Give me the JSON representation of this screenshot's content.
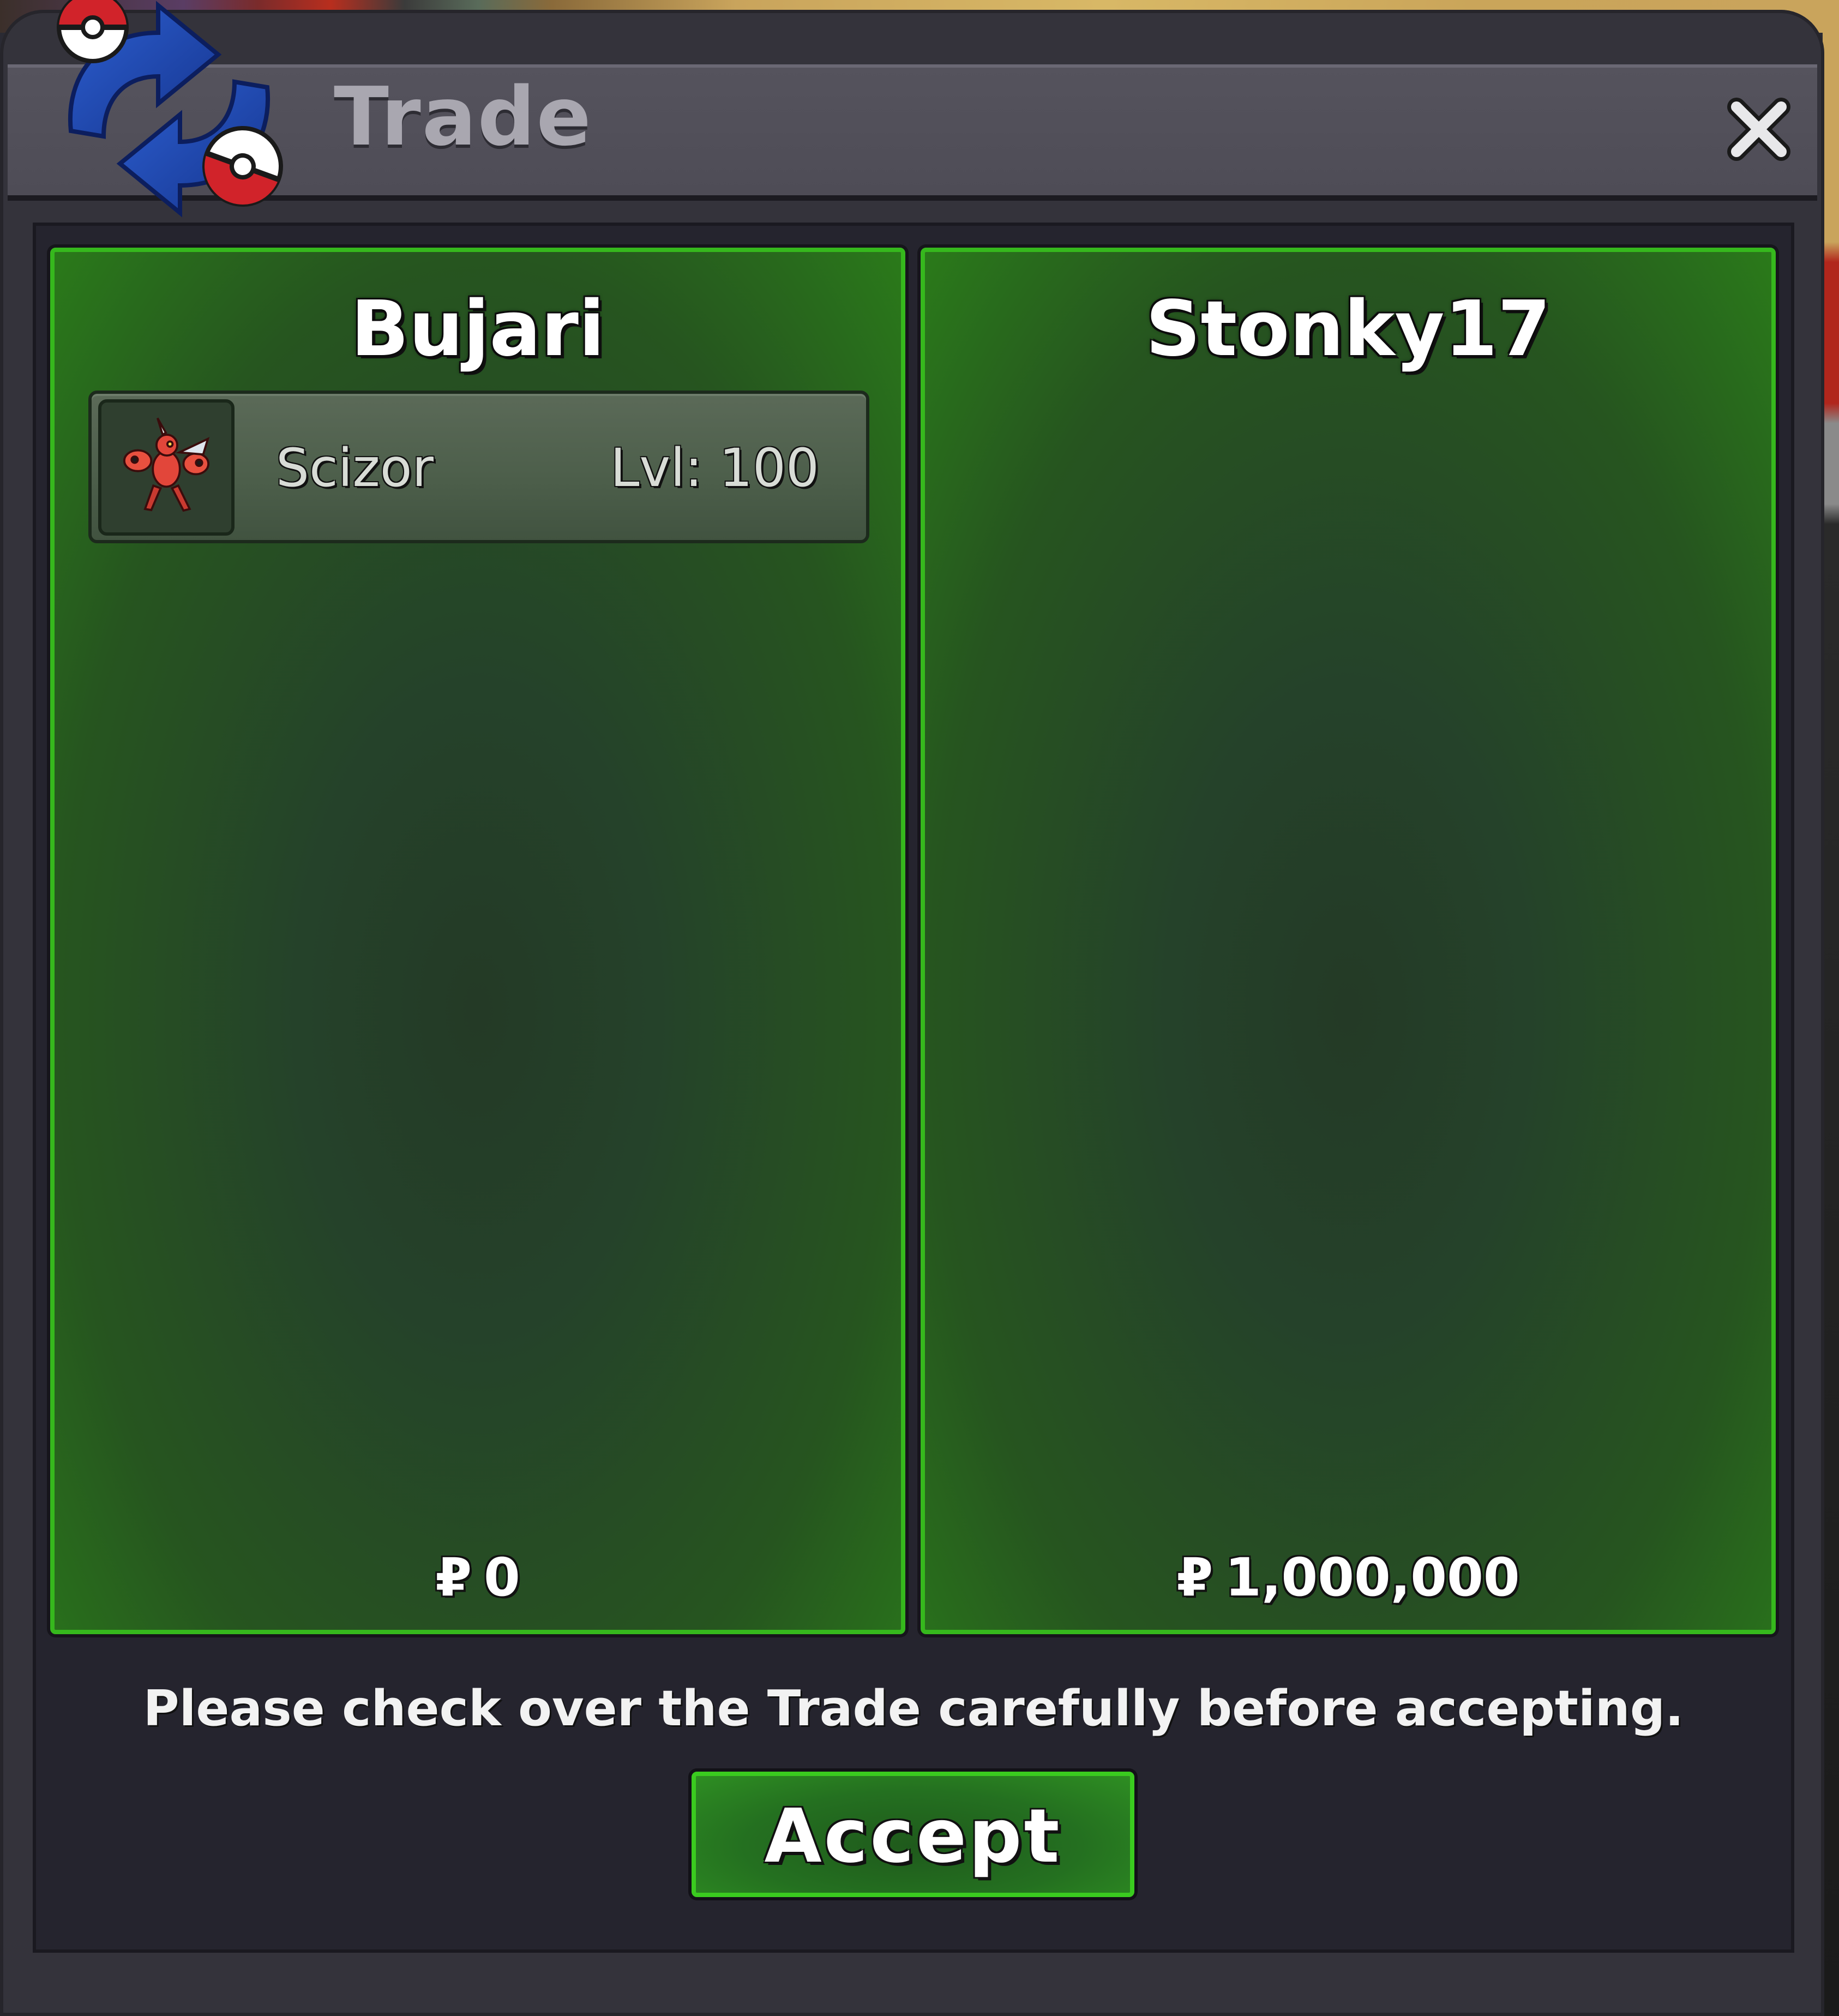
{
  "window": {
    "title": "Trade",
    "close_icon": "close-icon",
    "logo_icon": "trade-swap-pokeballs-icon"
  },
  "trade": {
    "left": {
      "player_name": "Bujari",
      "items": [
        {
          "icon": "scizor-sprite-icon",
          "name": "Scizor",
          "level": "Lvl: 100"
        }
      ],
      "currency_symbol": "₽",
      "money": "0"
    },
    "right": {
      "player_name": "Stonky17",
      "items": [],
      "currency_symbol": "₽",
      "money": "1,000,000"
    }
  },
  "footer": {
    "notice": "Please check over the Trade carefully before accepting.",
    "accept_label": "Accept"
  },
  "colors": {
    "panel_border": "#36b81d",
    "window_bg": "#34333b",
    "title_text": "#a9a7b0"
  }
}
